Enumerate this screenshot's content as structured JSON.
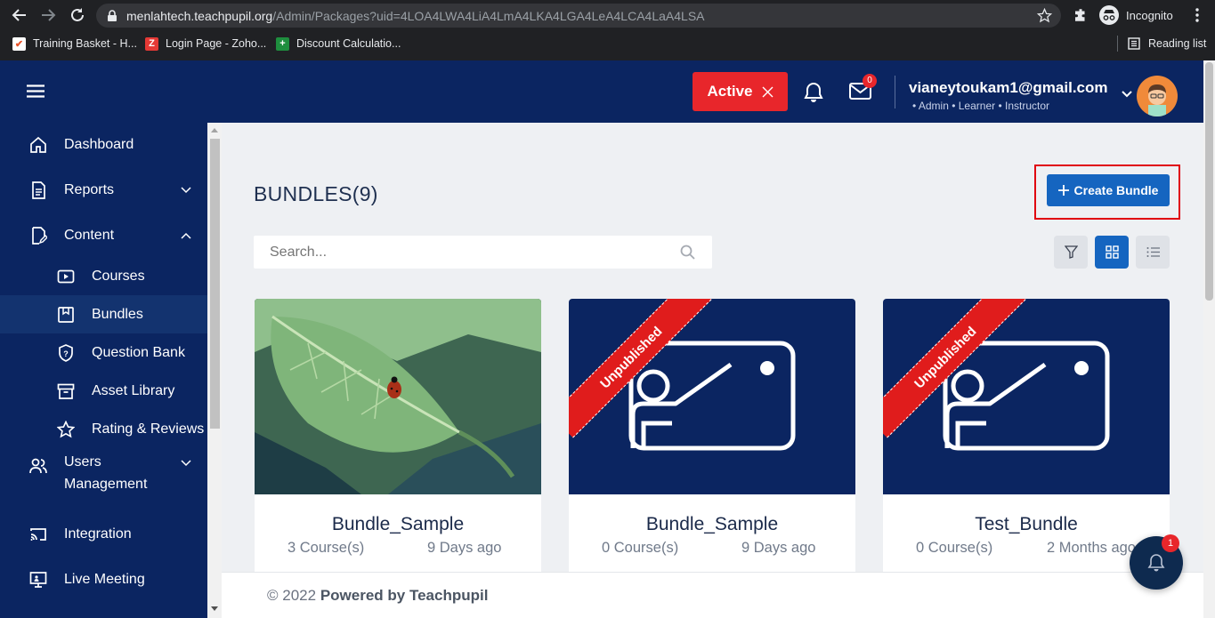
{
  "browser": {
    "url_host": "menlahtech.teachpupil.org",
    "url_path": "/Admin/Packages?uid=4LOA4LWA4LiA4LmA4LKA4LGA4LeA4LCA4LaA4LSA",
    "profile_label": "Incognito",
    "bookmarks": [
      "Training Basket - H...",
      "Login Page - Zoho...",
      "Discount Calculatio..."
    ],
    "reading_list": "Reading list"
  },
  "header": {
    "status_label": "Active",
    "mail_badge": "0",
    "user_email": "vianeytoukam1@gmail.com",
    "user_roles": "• Admin • Learner • Instructor"
  },
  "sidebar": {
    "items": [
      {
        "label": "Dashboard"
      },
      {
        "label": "Reports"
      },
      {
        "label": "Content"
      },
      {
        "label": "Courses"
      },
      {
        "label": "Bundles"
      },
      {
        "label": "Question Bank"
      },
      {
        "label": "Asset Library"
      },
      {
        "label": "Rating & Reviews"
      },
      {
        "label": "Users"
      },
      {
        "label": "Management"
      },
      {
        "label": "Integration"
      },
      {
        "label": "Live Meeting"
      }
    ]
  },
  "main": {
    "page_title": "BUNDLES(9)",
    "create_label": "Create Bundle",
    "search_placeholder": "Search...",
    "cards": [
      {
        "title": "Bundle_Sample",
        "courses": "3 Course(s)",
        "age": "9 Days ago",
        "ribbon": ""
      },
      {
        "title": "Bundle_Sample",
        "courses": "0 Course(s)",
        "age": "9 Days ago",
        "ribbon": "Unpublished"
      },
      {
        "title": "Test_Bundle",
        "courses": "0 Course(s)",
        "age": "2 Months ago",
        "ribbon": "Unpublished"
      }
    ],
    "notification_badge": "1"
  },
  "footer": {
    "copyright": "© 2022",
    "powered": "Powered by Teachpupil"
  },
  "colors": {
    "navy": "#0b2561",
    "primary": "#1565c0",
    "danger": "#e8262b"
  }
}
